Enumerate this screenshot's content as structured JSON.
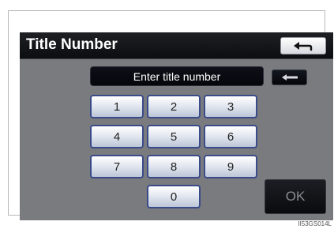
{
  "header": {
    "title": "Title Number"
  },
  "input": {
    "placeholder": "Enter title number"
  },
  "keys": [
    "1",
    "2",
    "3",
    "4",
    "5",
    "6",
    "7",
    "8",
    "9",
    "0"
  ],
  "actions": {
    "ok_label": "OK",
    "back_icon": "return-arrow-icon",
    "backspace_icon": "left-arrow-icon"
  },
  "footer": {
    "image_code": "II53GS014L"
  }
}
